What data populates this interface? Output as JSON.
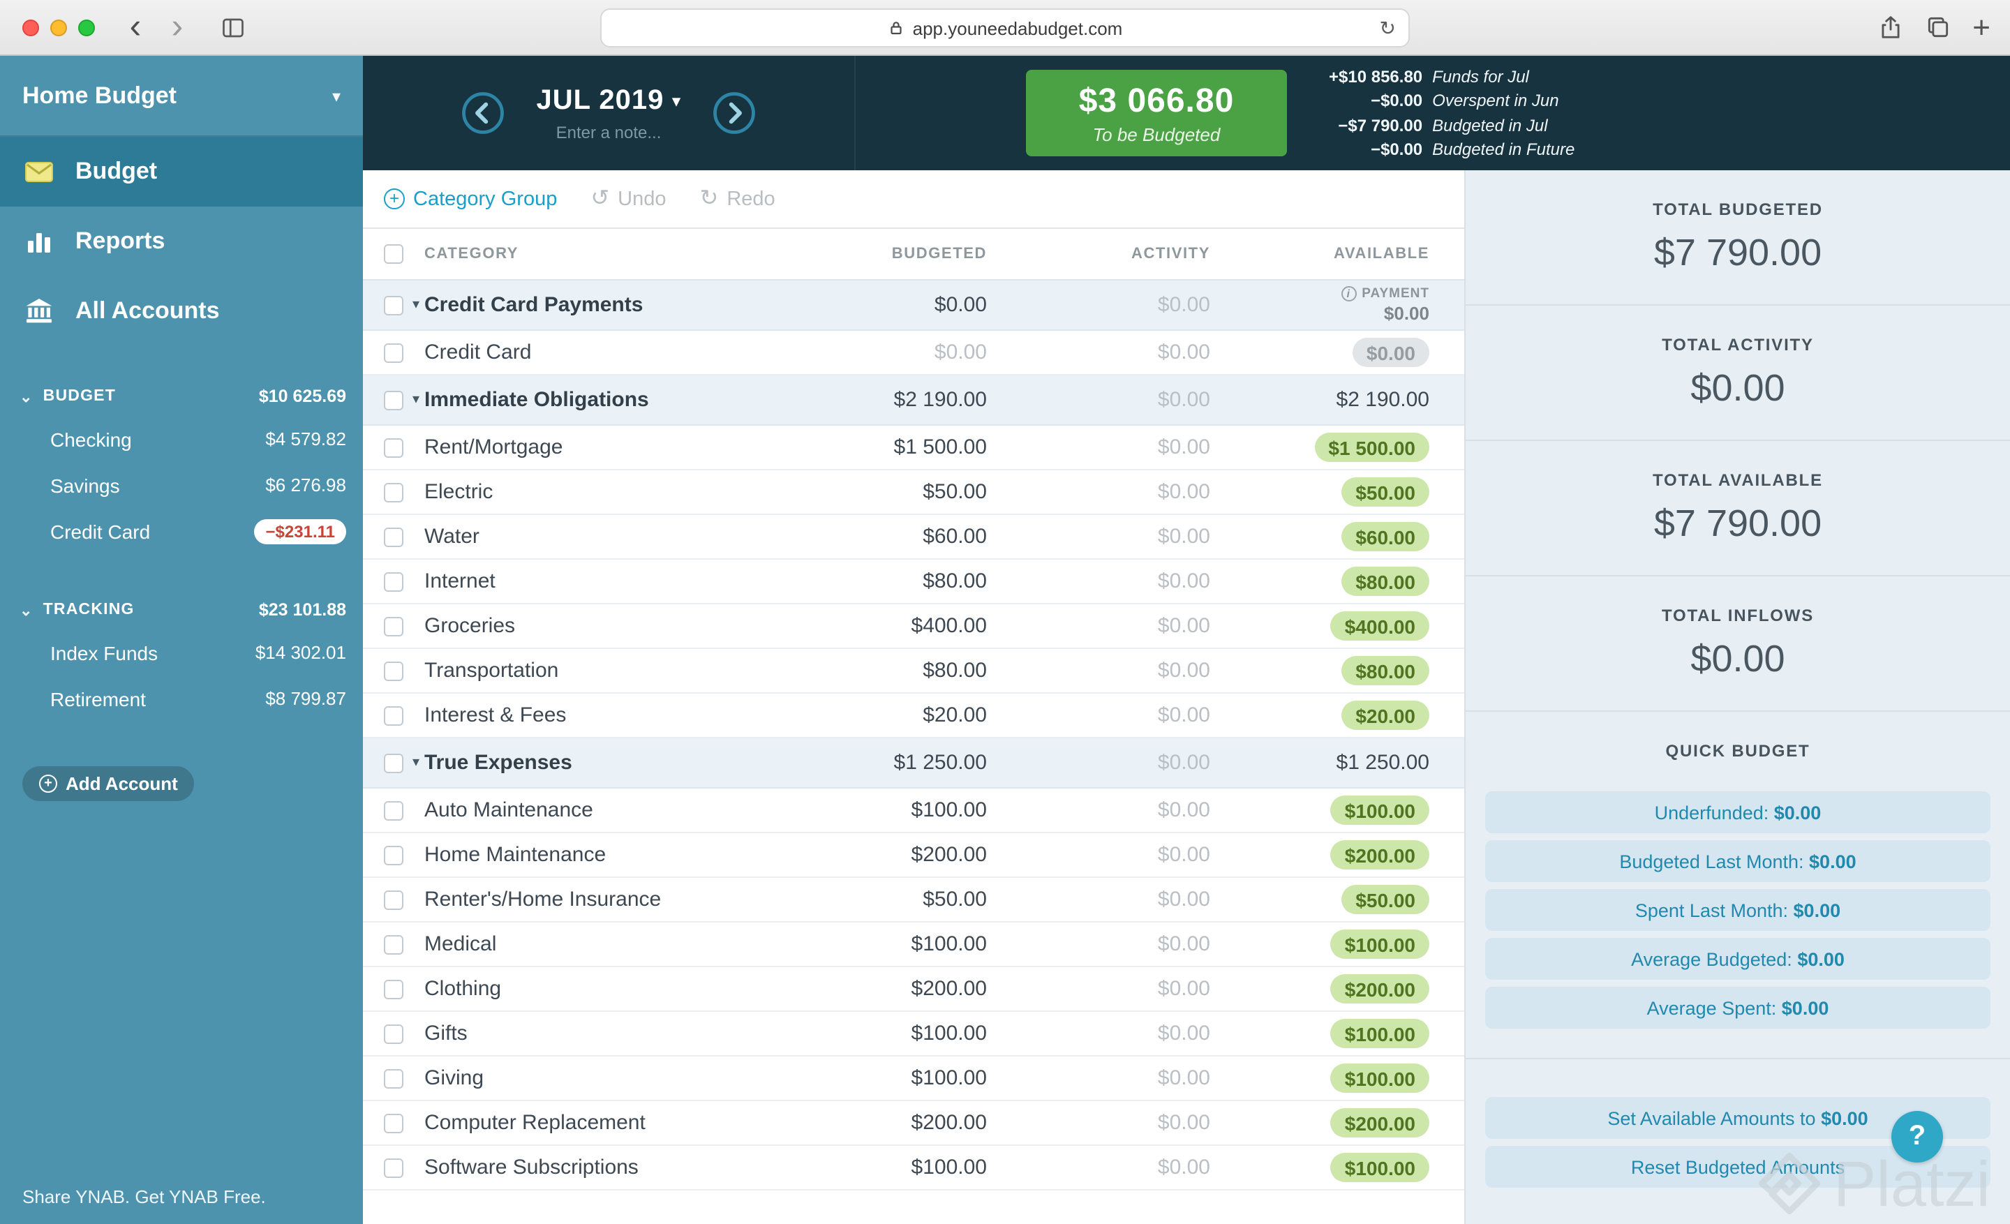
{
  "browser": {
    "url": "app.youneedabudget.com"
  },
  "icons": {
    "back": "‹",
    "forward": "›",
    "refresh": "↻",
    "new_tab": "+",
    "caret_down": "▾",
    "chevron_down": "⌄",
    "collapse": "▾",
    "undo": "↺",
    "redo": "↻",
    "plus": "+",
    "help": "?",
    "info": "i"
  },
  "sidebar": {
    "budget_name": "Home Budget",
    "nav": [
      {
        "id": "budget",
        "label": "Budget",
        "icon": "envelope-icon",
        "active": true
      },
      {
        "id": "reports",
        "label": "Reports",
        "icon": "bar-chart-icon",
        "active": false
      },
      {
        "id": "all-accounts",
        "label": "All Accounts",
        "icon": "bank-icon",
        "active": false
      }
    ],
    "account_groups": [
      {
        "label": "BUDGET",
        "total": "$10 625.69",
        "accounts": [
          {
            "name": "Checking",
            "amount": "$4 579.82",
            "negative": false
          },
          {
            "name": "Savings",
            "amount": "$6 276.98",
            "negative": false
          },
          {
            "name": "Credit Card",
            "amount": "−$231.11",
            "negative": true
          }
        ]
      },
      {
        "label": "TRACKING",
        "total": "$23 101.88",
        "accounts": [
          {
            "name": "Index Funds",
            "amount": "$14 302.01",
            "negative": false
          },
          {
            "name": "Retirement",
            "amount": "$8 799.87",
            "negative": false
          }
        ]
      }
    ],
    "add_account_label": "Add Account",
    "footer_text": "Share YNAB. Get YNAB Free."
  },
  "header": {
    "month": "JUL 2019",
    "note_placeholder": "Enter a note...",
    "to_be_budgeted_amount": "$3 066.80",
    "to_be_budgeted_label": "To be Budgeted",
    "breakdown": [
      {
        "amount": "+$10 856.80",
        "label": "Funds for Jul"
      },
      {
        "amount": "−$0.00",
        "label": "Overspent in Jun"
      },
      {
        "amount": "−$7 790.00",
        "label": "Budgeted in Jul"
      },
      {
        "amount": "−$0.00",
        "label": "Budgeted in Future"
      }
    ]
  },
  "toolbar": {
    "category_group_label": "Category Group",
    "undo_label": "Undo",
    "redo_label": "Redo"
  },
  "table": {
    "headers": {
      "category": "CATEGORY",
      "budgeted": "BUDGETED",
      "activity": "ACTIVITY",
      "available": "AVAILABLE"
    },
    "rows": [
      {
        "type": "group",
        "name": "Credit Card Payments",
        "budgeted": "$0.00",
        "activity": "$0.00",
        "available": "$0.00",
        "available_tag": "PAYMENT"
      },
      {
        "type": "category",
        "name": "Credit Card",
        "budgeted": "$0.00",
        "activity": "$0.00",
        "available": "$0.00",
        "pill": "gray",
        "muted_budgeted": true
      },
      {
        "type": "group",
        "name": "Immediate Obligations",
        "budgeted": "$2 190.00",
        "activity": "$0.00",
        "available": "$2 190.00"
      },
      {
        "type": "category",
        "name": "Rent/Mortgage",
        "budgeted": "$1 500.00",
        "activity": "$0.00",
        "available": "$1 500.00",
        "pill": "green"
      },
      {
        "type": "category",
        "name": "Electric",
        "budgeted": "$50.00",
        "activity": "$0.00",
        "available": "$50.00",
        "pill": "green"
      },
      {
        "type": "category",
        "name": "Water",
        "budgeted": "$60.00",
        "activity": "$0.00",
        "available": "$60.00",
        "pill": "green"
      },
      {
        "type": "category",
        "name": "Internet",
        "budgeted": "$80.00",
        "activity": "$0.00",
        "available": "$80.00",
        "pill": "green"
      },
      {
        "type": "category",
        "name": "Groceries",
        "budgeted": "$400.00",
        "activity": "$0.00",
        "available": "$400.00",
        "pill": "green"
      },
      {
        "type": "category",
        "name": "Transportation",
        "budgeted": "$80.00",
        "activity": "$0.00",
        "available": "$80.00",
        "pill": "green"
      },
      {
        "type": "category",
        "name": "Interest & Fees",
        "budgeted": "$20.00",
        "activity": "$0.00",
        "available": "$20.00",
        "pill": "green"
      },
      {
        "type": "group",
        "name": "True Expenses",
        "budgeted": "$1 250.00",
        "activity": "$0.00",
        "available": "$1 250.00"
      },
      {
        "type": "category",
        "name": "Auto Maintenance",
        "budgeted": "$100.00",
        "activity": "$0.00",
        "available": "$100.00",
        "pill": "green"
      },
      {
        "type": "category",
        "name": "Home Maintenance",
        "budgeted": "$200.00",
        "activity": "$0.00",
        "available": "$200.00",
        "pill": "green"
      },
      {
        "type": "category",
        "name": "Renter's/Home Insurance",
        "budgeted": "$50.00",
        "activity": "$0.00",
        "available": "$50.00",
        "pill": "green"
      },
      {
        "type": "category",
        "name": "Medical",
        "budgeted": "$100.00",
        "activity": "$0.00",
        "available": "$100.00",
        "pill": "green"
      },
      {
        "type": "category",
        "name": "Clothing",
        "budgeted": "$200.00",
        "activity": "$0.00",
        "available": "$200.00",
        "pill": "green"
      },
      {
        "type": "category",
        "name": "Gifts",
        "budgeted": "$100.00",
        "activity": "$0.00",
        "available": "$100.00",
        "pill": "green"
      },
      {
        "type": "category",
        "name": "Giving",
        "budgeted": "$100.00",
        "activity": "$0.00",
        "available": "$100.00",
        "pill": "green"
      },
      {
        "type": "category",
        "name": "Computer Replacement",
        "budgeted": "$200.00",
        "activity": "$0.00",
        "available": "$200.00",
        "pill": "green"
      },
      {
        "type": "category",
        "name": "Software Subscriptions",
        "budgeted": "$100.00",
        "activity": "$0.00",
        "available": "$100.00",
        "pill": "green"
      }
    ]
  },
  "inspector": {
    "totals": [
      {
        "label": "TOTAL BUDGETED",
        "value": "$7 790.00"
      },
      {
        "label": "TOTAL ACTIVITY",
        "value": "$0.00"
      },
      {
        "label": "TOTAL AVAILABLE",
        "value": "$7 790.00"
      },
      {
        "label": "TOTAL INFLOWS",
        "value": "$0.00"
      }
    ],
    "quick_budget_title": "QUICK BUDGET",
    "quick_budget_buttons": [
      {
        "label": "Underfunded:",
        "amount": "$0.00"
      },
      {
        "label": "Budgeted Last Month:",
        "amount": "$0.00"
      },
      {
        "label": "Spent Last Month:",
        "amount": "$0.00"
      },
      {
        "label": "Average Budgeted:",
        "amount": "$0.00"
      },
      {
        "label": "Average Spent:",
        "amount": "$0.00"
      }
    ],
    "action_buttons": [
      {
        "label": "Set Available Amounts to",
        "amount": "$0.00"
      },
      {
        "label": "Reset Budgeted Amounts",
        "amount": ""
      }
    ],
    "watermark": "Platzi"
  },
  "colors": {
    "sidebar": "#4e93ad",
    "sidebar_active": "#2d7b96",
    "header": "#17333f",
    "to_be_budgeted_green": "#4ba244",
    "link_teal": "#1a9fc9",
    "pill_green_bg": "#cde7ab",
    "pill_green_text": "#50741f",
    "negative_red": "#c74437",
    "inspector_bg": "#e7eff4",
    "quick_budget_button_bg": "#d5e6f0"
  }
}
